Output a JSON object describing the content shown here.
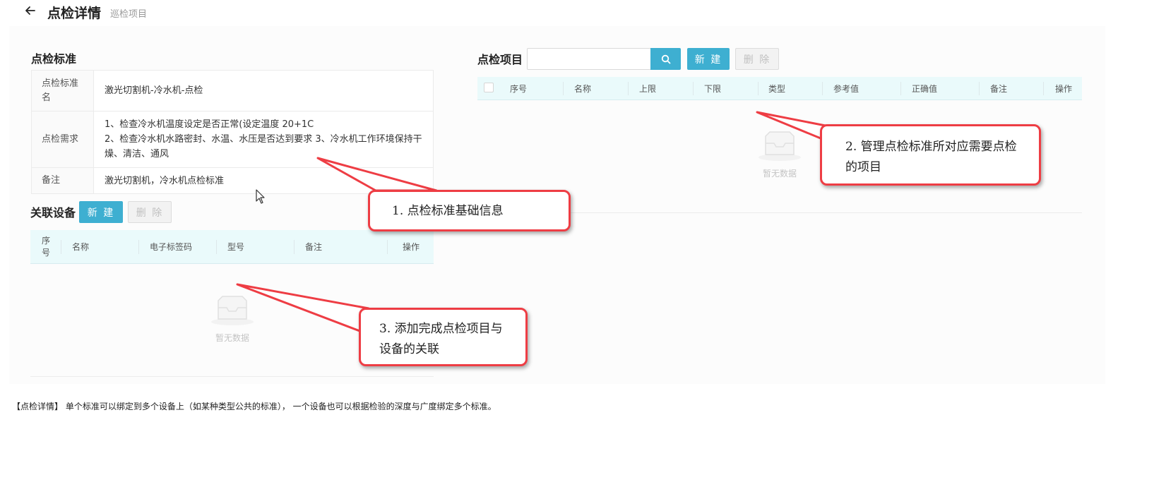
{
  "header": {
    "title": "点检详情",
    "subtitle": "巡检项目"
  },
  "standard": {
    "section_title": "点检标准",
    "rows": [
      {
        "label": "点检标准名",
        "value": "激光切割机-冷水机-点检"
      },
      {
        "label": "点检需求",
        "value": "1、检查冷水机温度设定是否正常(设定温度 20+1C\n2、检查冷水机水路密封、水温、水压是否达到要求 3、冷水机工作环境保持干燥、清洁、通风"
      },
      {
        "label": "备注",
        "value": "激光切割机，冷水机点检标准"
      }
    ]
  },
  "devices": {
    "section_title": "关联设备",
    "new_label": "新 建",
    "delete_label": "删 除",
    "columns": [
      "序号",
      "名称",
      "电子标签码",
      "型号",
      "备注",
      "操作"
    ],
    "empty_text": "暂无数据"
  },
  "items": {
    "section_title": "点检项目",
    "search_value": "",
    "new_label": "新 建",
    "delete_label": "删 除",
    "columns": [
      "序号",
      "名称",
      "上限",
      "下限",
      "类型",
      "参考值",
      "正确值",
      "备注",
      "操作"
    ],
    "empty_text": "暂无数据"
  },
  "callouts": [
    {
      "text": "1. 点检标准基础信息"
    },
    {
      "text": "2. 管理点检标准所对应需要点检的项目"
    },
    {
      "text": "3. 添加完成点检项目与设备的关联"
    }
  ],
  "caption": "【点检详情】 单个标准可以绑定到多个设备上（如某种类型公共的标准）， 一个设备也可以根据检验的深度与广度绑定多个标准。",
  "colors": {
    "primary": "#3eafd1",
    "callout_border": "#ee3d44",
    "table_header": "#eafafb"
  }
}
